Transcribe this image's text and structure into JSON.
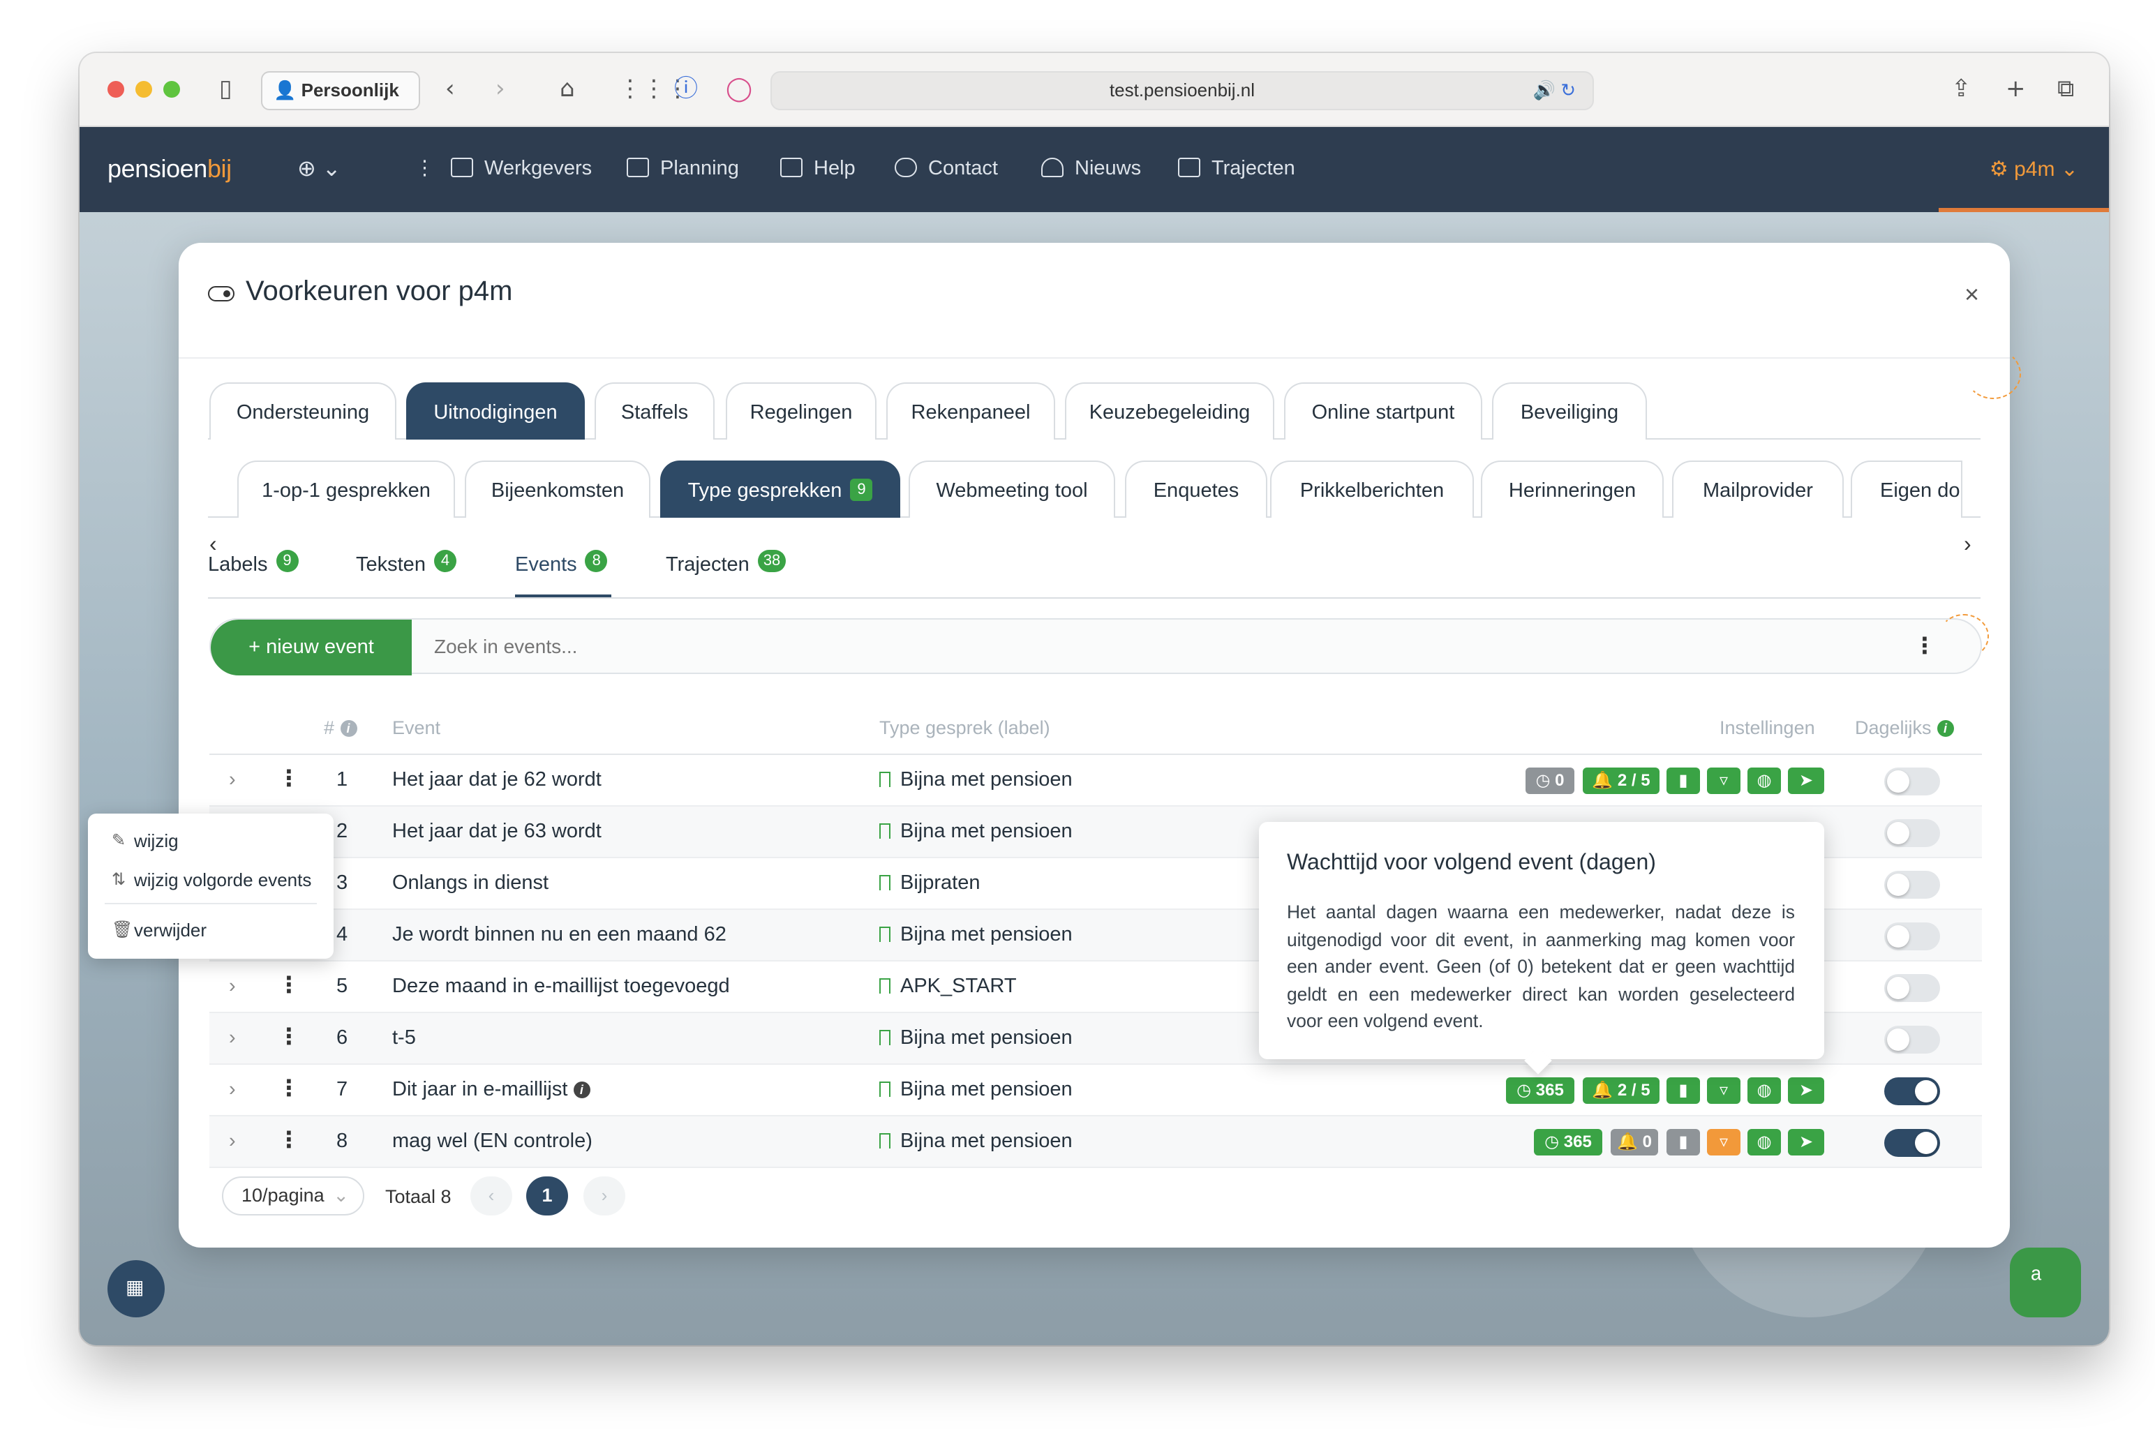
{
  "browser": {
    "profile": "Persoonlijk",
    "url": "test.pensioenbij.nl"
  },
  "app": {
    "logo_main": "pensioen",
    "logo_accent": "bij",
    "nav": [
      "Werkgevers",
      "Planning",
      "Help",
      "Contact",
      "Nieuws",
      "Trajecten"
    ],
    "user": "p4m"
  },
  "modal": {
    "title": "Voorkeuren voor p4m",
    "close": "×"
  },
  "tabs_main": [
    "Ondersteuning",
    "Uitnodigingen",
    "Staffels",
    "Regelingen",
    "Rekenpaneel",
    "Keuzebegeleiding",
    "Online startpunt",
    "Beveiliging"
  ],
  "tabs_main_active": "Uitnodigingen",
  "tabs_sub": [
    "1-op-1 gesprekken",
    "Bijeenkomsten",
    "Type gesprekken",
    "Webmeeting tool",
    "Enquetes",
    "Prikkelberichten",
    "Herinneringen",
    "Mailprovider",
    "Eigen do"
  ],
  "tabs_sub_active": "Type gesprekken",
  "tabs_sub_active_count": "9",
  "tabs_third": [
    {
      "label": "Labels",
      "count": "9"
    },
    {
      "label": "Teksten",
      "count": "4"
    },
    {
      "label": "Events",
      "count": "8"
    },
    {
      "label": "Trajecten",
      "count": "38"
    }
  ],
  "tabs_third_active": "Events",
  "toolbar": {
    "new_button": "+ nieuw event",
    "search_placeholder": "Zoek in events..."
  },
  "table": {
    "headers": {
      "num": "#",
      "event": "Event",
      "type": "Type gesprek (label)",
      "settings": "Instellingen",
      "daily": "Dagelijks"
    },
    "rows": [
      {
        "num": "1",
        "event": "Het jaar dat je 62 wordt",
        "type": "Bijna met pensioen",
        "wait": "0",
        "invites": "2 / 5",
        "daily": false
      },
      {
        "num": "2",
        "event": "Het jaar dat je 63 wordt",
        "type": "Bijna met pensioen",
        "daily": false
      },
      {
        "num": "3",
        "event": "Onlangs in dienst",
        "type": "Bijpraten",
        "daily": false
      },
      {
        "num": "4",
        "event": "Je wordt binnen nu en een maand 62",
        "type": "Bijna met pensioen",
        "daily": false
      },
      {
        "num": "5",
        "event": "Deze maand in e-maillijst toegevoegd",
        "type": "APK_START",
        "daily": false
      },
      {
        "num": "6",
        "event": "t-5",
        "type": "Bijna met pensioen",
        "daily": false
      },
      {
        "num": "7",
        "event": "Dit jaar in e-maillijst",
        "type": "Bijna met pensioen",
        "wait": "365",
        "invites": "2 / 5",
        "daily": true
      },
      {
        "num": "8",
        "event": "mag wel (EN controle)",
        "type": "Bijna met pensioen",
        "wait": "365",
        "invites": "0",
        "daily": true
      }
    ]
  },
  "pagination": {
    "per_page": "10/pagina",
    "total": "Totaal 8",
    "current": "1"
  },
  "context_menu": [
    "wijzig",
    "wijzig volgorde events",
    "verwijder"
  ],
  "tooltip": {
    "title": "Wachttijd voor volgend event (dagen)",
    "body": "Het aantal dagen waarna een medewerker, nadat deze is uitgenodigd voor dit event, in aanmerking mag komen voor een ander event. Geen (of 0) betekent dat er geen wachttijd geldt en een medewerker direct kan worden geselecteerd voor een volgend event."
  },
  "colors": {
    "navy": "#2e3d50",
    "active_tab": "#2e4a66",
    "green": "#3aa345",
    "orange": "#f2993a",
    "gray_pill": "#8f9498"
  }
}
